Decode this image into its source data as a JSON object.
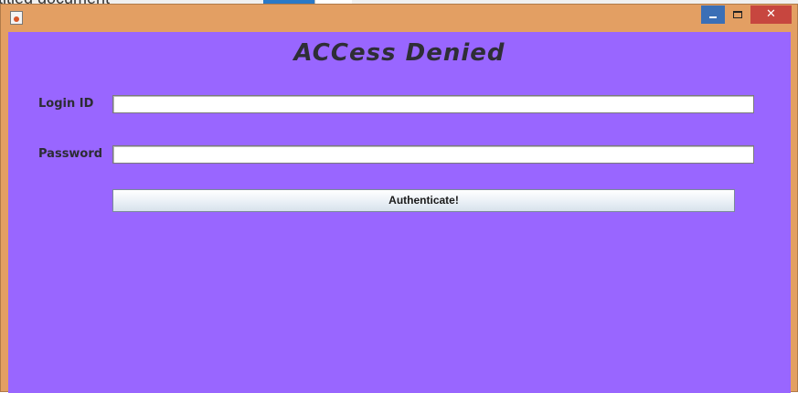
{
  "background": {
    "document_text": "ititled document",
    "blue_accent": "#2a79c7"
  },
  "window": {
    "icon": "java-app-icon",
    "frame_color": "#e39f63",
    "controls": {
      "minimize_icon": "minimize-icon",
      "maximize_icon": "maximize-icon",
      "close_symbol": "✕"
    }
  },
  "panel": {
    "background_color": "#9966ff",
    "heading": "ACCess Denied"
  },
  "form": {
    "login_label": "Login ID",
    "login_value": "",
    "password_label": "Password",
    "password_value": "",
    "submit_label": "Authenticate!"
  }
}
